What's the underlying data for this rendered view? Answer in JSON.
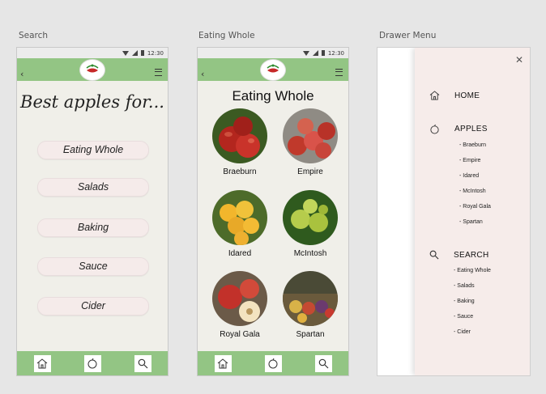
{
  "labels": {
    "search": "Search",
    "eating_whole": "Eating Whole",
    "drawer_menu": "Drawer Menu"
  },
  "statusbar": {
    "time": "12:30"
  },
  "search_screen": {
    "heading": "Best apples for...",
    "options": [
      "Eating Whole",
      "Salads",
      "Baking",
      "Sauce",
      "Cider"
    ]
  },
  "eating_screen": {
    "title": "Eating Whole",
    "apples": [
      "Braeburn",
      "Empire",
      "Idared",
      "McIntosh",
      "Royal Gala",
      "Spartan"
    ]
  },
  "drawer": {
    "home": "HOME",
    "apples_head": "APPLES",
    "apples": [
      "- Braeburn",
      "- Empire",
      "- Idared",
      "- McIntosh",
      "- Royal Gala",
      "- Spartan"
    ],
    "search_head": "SEARCH",
    "search_items": [
      "- Eating Whole",
      "- Salads",
      "- Baking",
      "- Sauce",
      "- Cider"
    ]
  },
  "colors": {
    "bar": "#93c584",
    "screen_bg": "#f0efe9",
    "pill": "#f5ebea",
    "drawer": "#f6ecea"
  }
}
